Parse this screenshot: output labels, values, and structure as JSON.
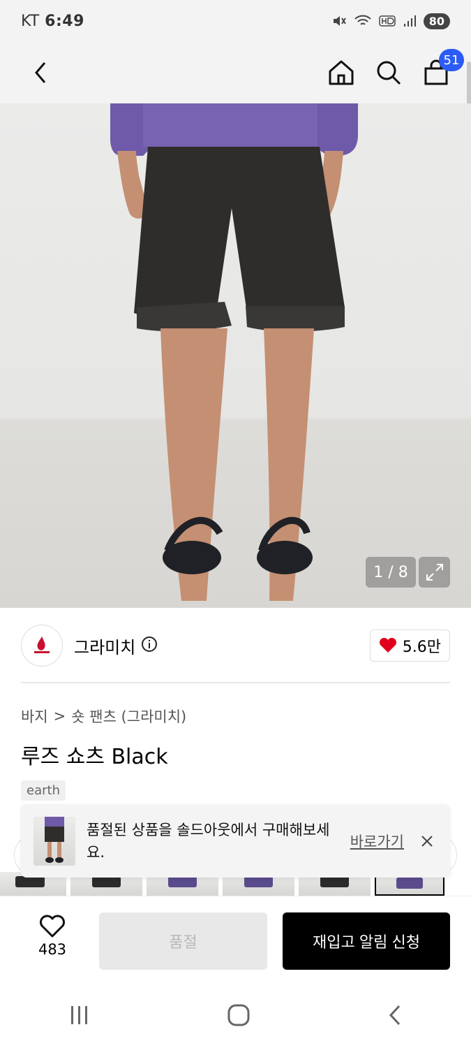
{
  "status_bar": {
    "carrier": "KT",
    "time": "6:49",
    "battery": "80"
  },
  "header": {
    "cart_count": "51"
  },
  "gallery": {
    "counter": "1 / 8"
  },
  "brand": {
    "name": "그라미치",
    "likes": "5.6만"
  },
  "breadcrumb": {
    "category": "바지",
    "separator": ">",
    "subcategory": "숏 팬츠 (그라미치)"
  },
  "product": {
    "title": "루즈 쇼츠 Black",
    "tag": "earth"
  },
  "toast": {
    "message": "품절된 상품을 솔드아웃에서 구매해보세요.",
    "link": "바로가기"
  },
  "bottom": {
    "wish_count": "483",
    "soldout_label": "품절",
    "restock_label": "재입고 알림 신청"
  },
  "colors": {
    "accent": "#2c5bf5",
    "heart": "#e0001b",
    "button_dark": "#000000"
  }
}
